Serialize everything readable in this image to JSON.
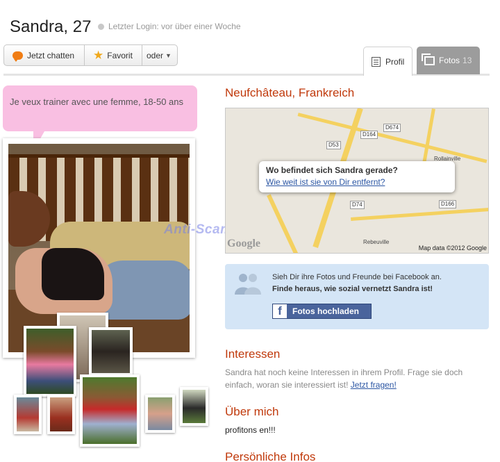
{
  "header": {
    "name_age": "Sandra, 27",
    "last_login": "Letzter Login: vor über einer Woche"
  },
  "actions": {
    "chat_label": "Jetzt chatten",
    "favorite_label": "Favorit",
    "more_label": "oder"
  },
  "tabs": {
    "profil_label": "Profil",
    "fotos_label": "Fotos",
    "fotos_count": "13"
  },
  "bubble_text": "Je veux trainer avec une femme, 18-50 ans",
  "watermark": "Anti-Scam-Forum-NL",
  "location": "Neufchâteau, Frankreich",
  "map": {
    "popup_title": "Wo befindet sich Sandra gerade?",
    "popup_link": "Wie weit ist sie von Dir entfernt?",
    "road_labels": [
      "D164",
      "D674",
      "D53",
      "D74",
      "D166"
    ],
    "towns": [
      "Rollainville",
      "Rebeuville"
    ],
    "attribution": "Map data ©2012 Google",
    "logo": "Google"
  },
  "facebook": {
    "text1": "Sieh Dir ihre Fotos und Freunde bei Facebook an.",
    "text2": "Finde heraus, wie sozial vernetzt Sandra ist!",
    "button_label": "Fotos hochladen"
  },
  "interests": {
    "title": "Interessen",
    "text": "Sandra hat noch keine Interessen in ihrem Profil. Frage sie doch einfach, woran sie interessiert ist!",
    "link": "Jetzt fragen!"
  },
  "about": {
    "title": "Über mich",
    "text": "profitons en!!!"
  },
  "personal": {
    "title": "Persönliche Infos"
  },
  "colors": {
    "accent_red": "#c0390b",
    "bubble_pink": "#f9bfe2",
    "link_blue": "#2a55a3",
    "facebook_blue": "#4a649c"
  }
}
